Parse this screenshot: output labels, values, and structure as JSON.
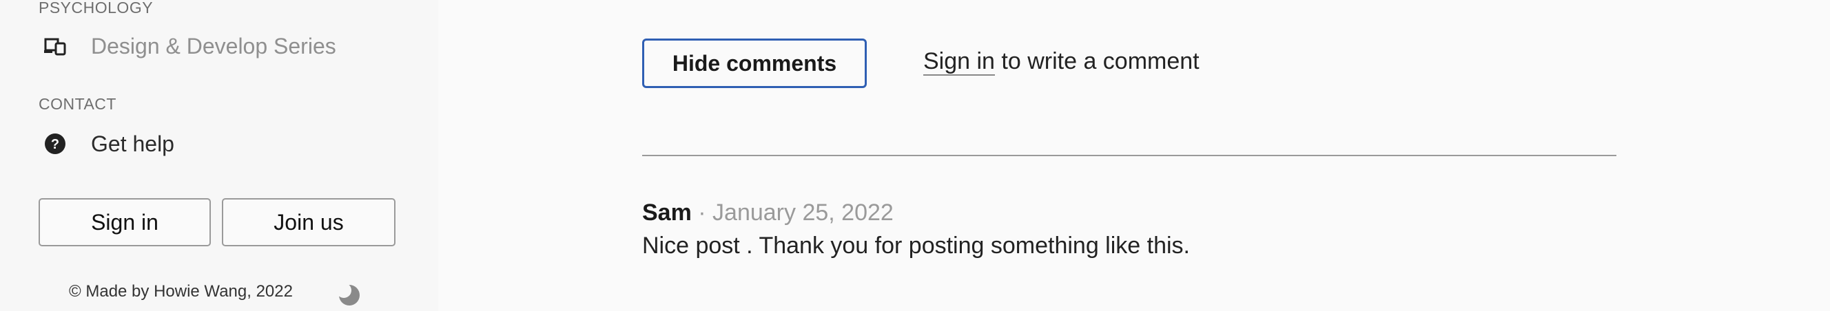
{
  "sidebar": {
    "section_psychology": "PSYCHOLOGY",
    "item_design": {
      "label": "Design & Develop Series",
      "icon": "devices-icon"
    },
    "section_contact": "CONTACT",
    "item_help": {
      "label": "Get help",
      "icon": "question-circle-icon"
    },
    "signin_label": "Sign in",
    "joinus_label": "Join us",
    "footer_text": "© Made by Howie Wang, 2022",
    "theme_icon": "moon-icon"
  },
  "main": {
    "hide_comments_label": "Hide comments",
    "signin_link": "Sign in",
    "signin_suffix": "to write a comment",
    "comments": [
      {
        "author": "Sam",
        "date": "· January 25, 2022",
        "text": "Nice post . Thank you for posting something like this."
      }
    ]
  },
  "colors": {
    "accent": "#2f5fb3",
    "muted": "#9a9a9a",
    "background": "#fafafa"
  }
}
